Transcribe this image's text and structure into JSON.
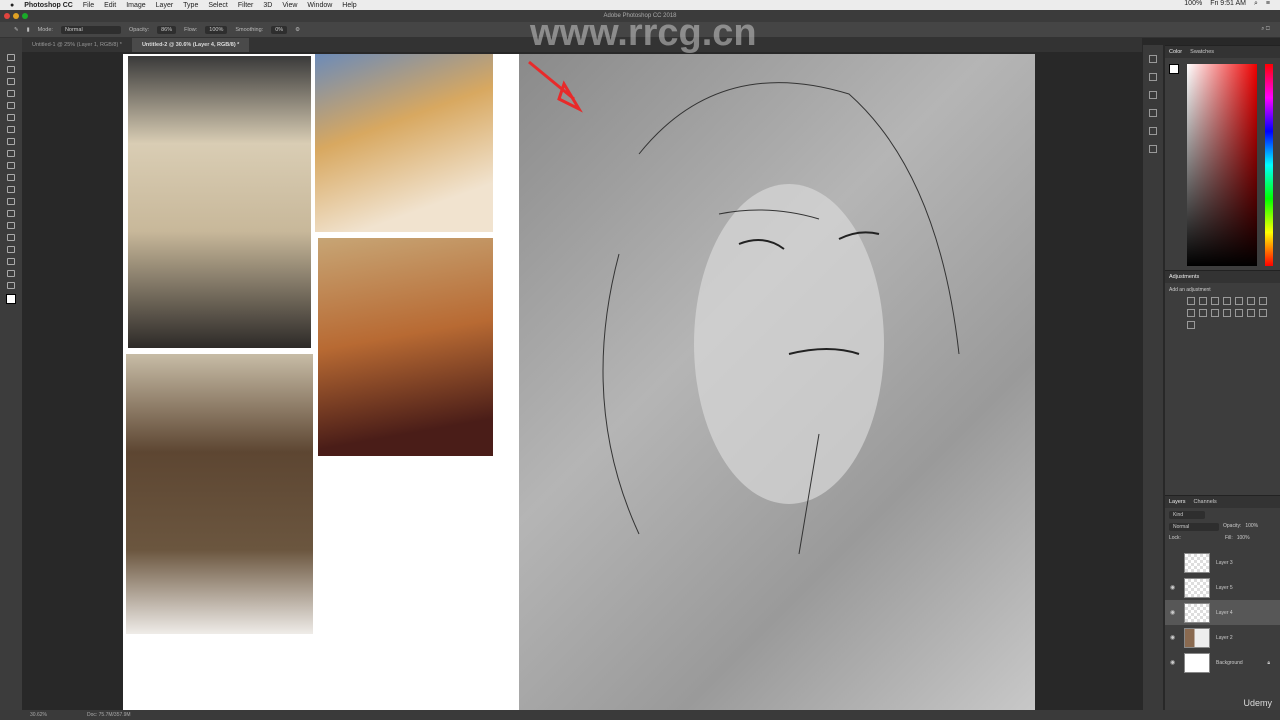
{
  "menubar": {
    "app": "Photoshop CC",
    "items": [
      "File",
      "Edit",
      "Image",
      "Layer",
      "Type",
      "Select",
      "Filter",
      "3D",
      "View",
      "Window",
      "Help"
    ],
    "battery": "100%",
    "clock": "Fri 9:51 AM"
  },
  "titlebar": {
    "title": "Adobe Photoshop CC 2018"
  },
  "options": {
    "mode_label": "Mode:",
    "mode": "Normal",
    "opacity_label": "Opacity:",
    "opacity": "86%",
    "flow_label": "Flow:",
    "flow": "100%",
    "smoothing_label": "Smoothing:",
    "smoothing": "0%"
  },
  "tabs": [
    {
      "label": "Untitled-1 @ 25% (Layer 1, RGB/8) *"
    },
    {
      "label": "Untitled-2 @ 30.6% (Layer 4, RGB/8) *"
    }
  ],
  "color_panel": {
    "tabs": [
      "Color",
      "Swatches"
    ]
  },
  "adjustments": {
    "title": "Adjustments",
    "subtitle": "Add an adjustment"
  },
  "layers_panel": {
    "tabs": [
      "Layers",
      "Channels"
    ],
    "kind": "Kind",
    "blend": "Normal",
    "opacity_label": "Opacity:",
    "opacity": "100%",
    "lock_label": "Lock:",
    "fill_label": "Fill:",
    "fill": "100%",
    "layers": [
      {
        "name": "Layer 3",
        "visible": false
      },
      {
        "name": "Layer 5",
        "visible": true
      },
      {
        "name": "Layer 4",
        "visible": true,
        "selected": true
      },
      {
        "name": "Layer 2",
        "visible": true
      },
      {
        "name": "Background",
        "visible": true
      }
    ]
  },
  "statusbar": {
    "zoom": "30.62%",
    "doc": "Doc: 75.7M/357.9M"
  },
  "watermark": {
    "url": "www.rrcg.cn",
    "brand": "Udemy"
  },
  "colors": {
    "accent": "#e82a2a"
  }
}
